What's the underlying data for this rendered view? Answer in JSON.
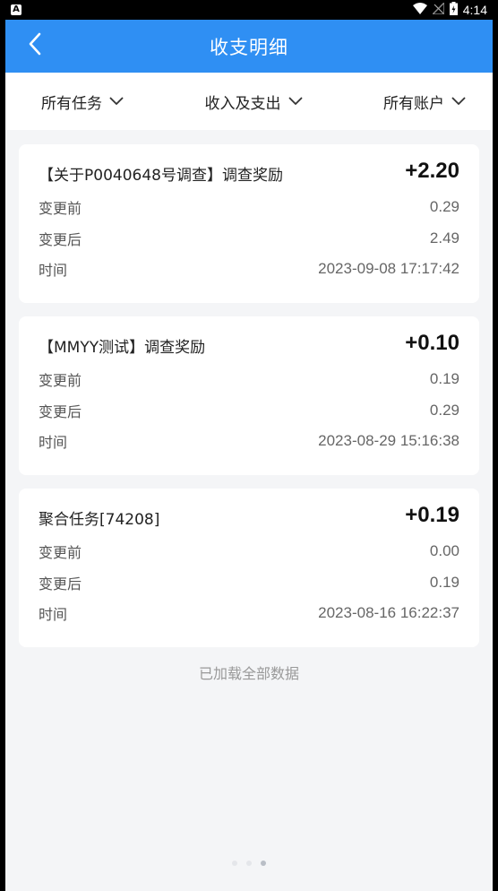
{
  "status_bar": {
    "left_badge": "A",
    "time": "4:14",
    "icons": [
      "wifi-icon",
      "no-signal-icon",
      "battery-icon"
    ]
  },
  "app_bar": {
    "title": "收支明细",
    "back_icon": "chevron-left-icon"
  },
  "filters": [
    {
      "label": "所有任务"
    },
    {
      "label": "收入及支出"
    },
    {
      "label": "所有账户"
    }
  ],
  "records": [
    {
      "title": "【关于P0040648号调查】调查奖励",
      "amount": "+2.20",
      "before_label": "变更前",
      "before": "0.29",
      "after_label": "变更后",
      "after": "2.49",
      "time_label": "时间",
      "time": "2023-09-08 17:17:42"
    },
    {
      "title": "【MMYY测试】调查奖励",
      "amount": "+0.10",
      "before_label": "变更前",
      "before": "0.19",
      "after_label": "变更后",
      "after": "0.29",
      "time_label": "时间",
      "time": "2023-08-29 15:16:38"
    },
    {
      "title": "聚合任务[74208]",
      "amount": "+0.19",
      "before_label": "变更前",
      "before": "0.00",
      "after_label": "变更后",
      "after": "0.19",
      "time_label": "时间",
      "time": "2023-08-16 16:22:37"
    }
  ],
  "footer_note": "已加载全部数据",
  "colors": {
    "primary": "#2f8ff3",
    "background": "#f4f5f7",
    "card": "#ffffff"
  }
}
